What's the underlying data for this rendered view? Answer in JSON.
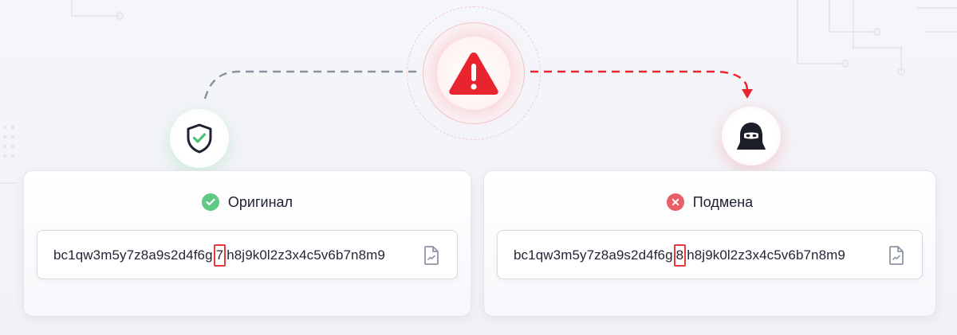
{
  "original": {
    "title": "Оригинал",
    "address_prefix": "bc1qw3m5y7z8a9s2d4f6g",
    "address_changed": "7",
    "address_suffix": "h8j9k0l2z3x4c5v6b7n8m9"
  },
  "substituted": {
    "title": "Подмена",
    "address_prefix": "bc1qw3m5y7z8a9s2d4f6g",
    "address_changed": "8",
    "address_suffix": "h8j9k0l2z3x4c5v6b7n8m9"
  },
  "icons": {
    "shield": "shield-check-icon",
    "alert": "warning-triangle-icon",
    "hacker": "hacker-icon",
    "ok": "check-circle-icon",
    "bad": "x-circle-icon",
    "copy": "copy-document-icon"
  },
  "colors": {
    "ok": "#5ec983",
    "danger": "#e8252f",
    "highlight": "#e23a3f",
    "line_gray": "#8b93a3"
  }
}
